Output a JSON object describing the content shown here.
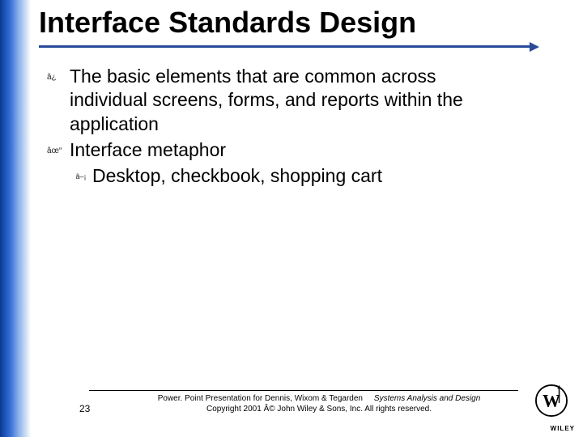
{
  "title": "Interface Standards Design",
  "bullets": [
    {
      "mark": "â¿",
      "text": "The basic elements that are common across individual screens, forms, and reports within the application",
      "children": []
    },
    {
      "mark": "âœ“",
      "text": "Interface metaphor",
      "children": [
        {
          "mark": "â–¡",
          "text": "Desktop, checkbook, shopping cart"
        }
      ]
    }
  ],
  "footer": {
    "page": "23",
    "line1_a": "Power. Point Presentation for Dennis, Wixom & Tegarden",
    "line1_b": "Systems Analysis and Design",
    "line2": "Copyright 2001 Â© John Wiley & Sons, Inc. All rights reserved."
  },
  "logo": {
    "name": "wiley-logo",
    "text": "WILEY"
  }
}
